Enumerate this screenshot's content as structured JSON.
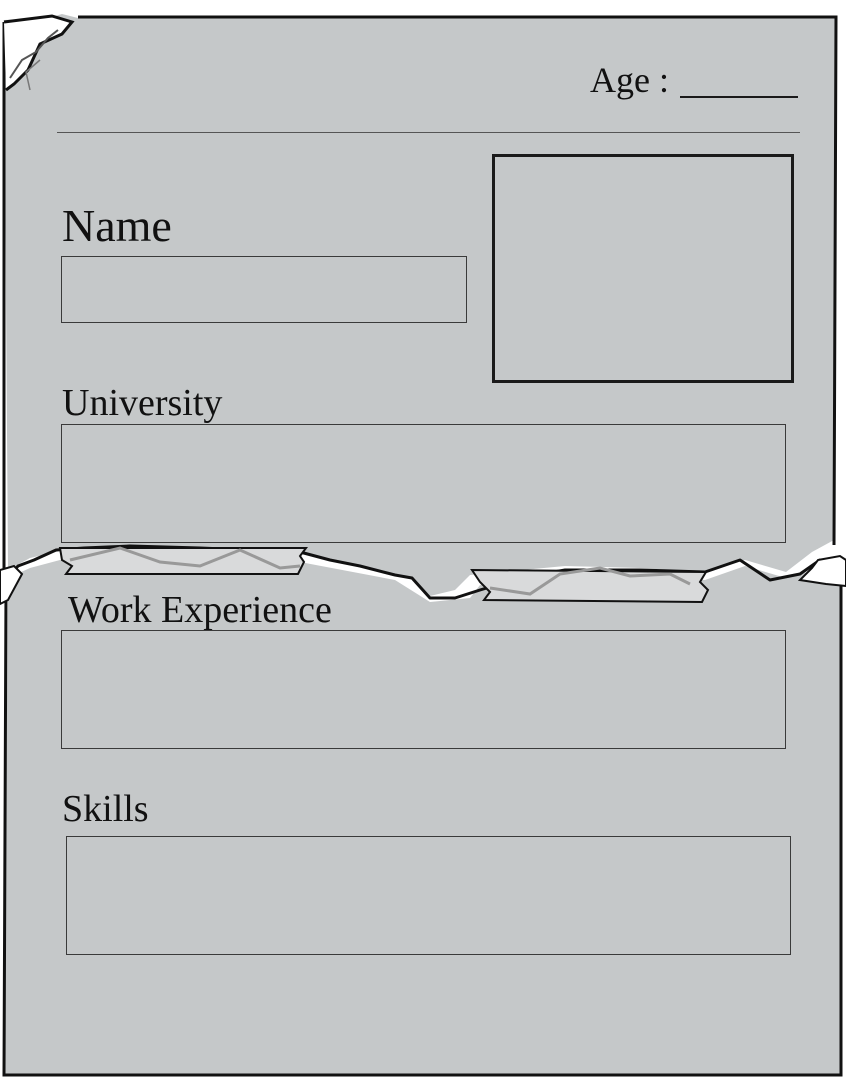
{
  "form": {
    "age_label": "Age :",
    "name_label": "Name",
    "university_label": "University",
    "work_experience_label": "Work Experience",
    "skills_label": "Skills",
    "name_value": "",
    "age_value": "",
    "university_value": "",
    "work_experience_value": "",
    "skills_value": ""
  },
  "colors": {
    "paper": "#c5c8c9",
    "ink": "#111111",
    "tape": "#d9dadb"
  }
}
